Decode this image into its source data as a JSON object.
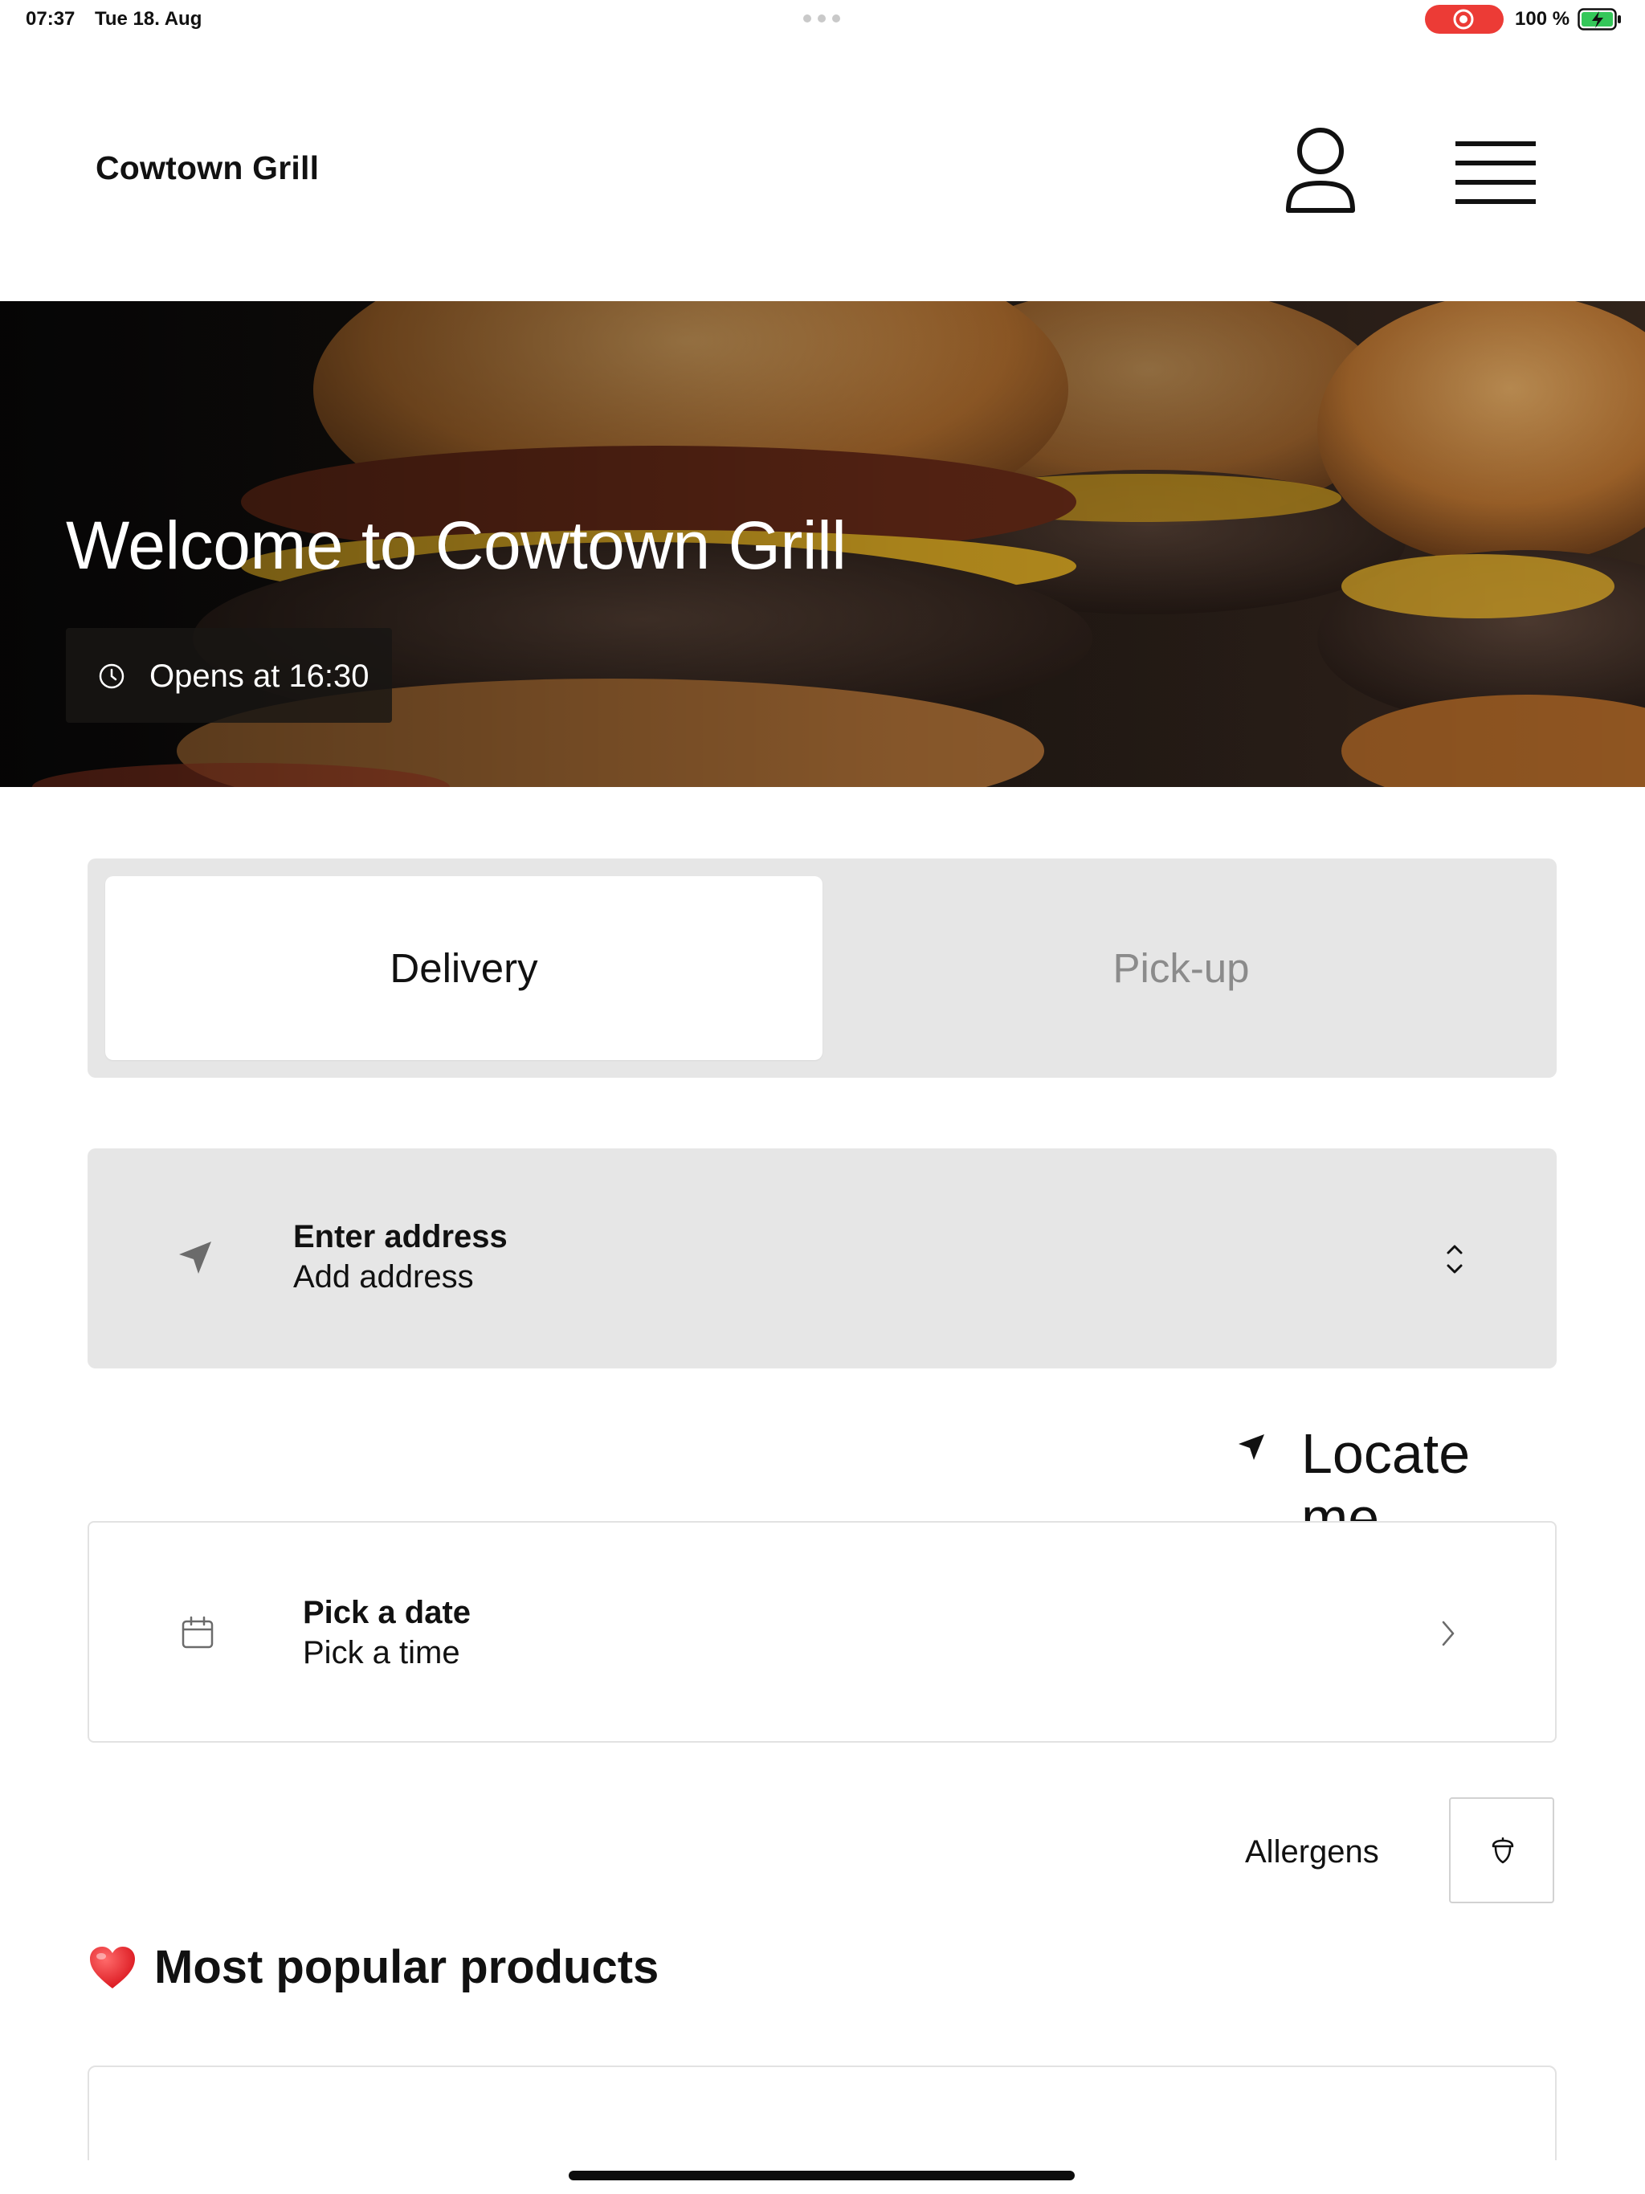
{
  "status_bar": {
    "time": "07:37",
    "date": "Tue 18. Aug",
    "battery": "100 %",
    "icons": [
      "screen-record-icon",
      "battery-charging-icon"
    ]
  },
  "header": {
    "brand": "Cowtown Grill",
    "icons": [
      "user-profile-icon",
      "hamburger-menu-icon"
    ]
  },
  "hero": {
    "title": "Welcome to Cowtown Grill",
    "opening": "Opens at 16:30",
    "icon": "clock-icon"
  },
  "order_mode": {
    "selected": "Delivery",
    "options": [
      "Delivery",
      "Pick-up"
    ]
  },
  "address": {
    "title": "Enter address",
    "subtitle": "Add address",
    "icons": [
      "location-arrow-icon",
      "up-down-chevron-icon"
    ]
  },
  "locate_me": {
    "label": "Locate me",
    "icon": "location-arrow-icon"
  },
  "schedule": {
    "title": "Pick a date",
    "subtitle": "Pick a time",
    "icons": [
      "calendar-icon",
      "chevron-right-icon"
    ]
  },
  "allergens": {
    "label": "Allergens",
    "icon": "acorn-allergen-icon"
  },
  "popular": {
    "emoji": "❤️",
    "title": "Most popular products"
  },
  "colors": {
    "accent_segment": "#e6e6e6",
    "inactive_text": "#8b8b8b",
    "record_red": "#ec3b36",
    "battery_green": "#34c759"
  }
}
